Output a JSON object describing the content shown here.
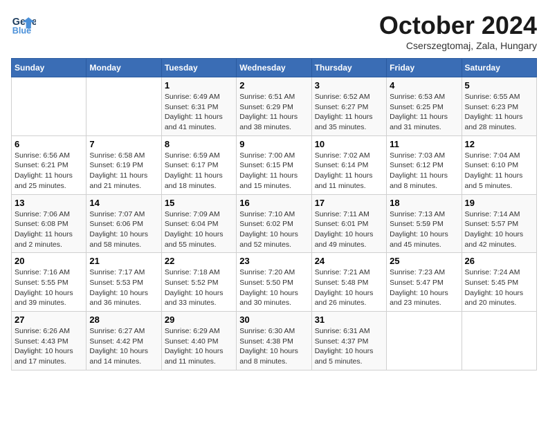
{
  "header": {
    "logo_line1": "General",
    "logo_line2": "Blue",
    "month_title": "October 2024",
    "subtitle": "Cserszegtomaj, Zala, Hungary"
  },
  "days_of_week": [
    "Sunday",
    "Monday",
    "Tuesday",
    "Wednesday",
    "Thursday",
    "Friday",
    "Saturday"
  ],
  "weeks": [
    [
      {
        "day": "",
        "sunrise": "",
        "sunset": "",
        "daylight": ""
      },
      {
        "day": "",
        "sunrise": "",
        "sunset": "",
        "daylight": ""
      },
      {
        "day": "1",
        "sunrise": "Sunrise: 6:49 AM",
        "sunset": "Sunset: 6:31 PM",
        "daylight": "Daylight: 11 hours and 41 minutes."
      },
      {
        "day": "2",
        "sunrise": "Sunrise: 6:51 AM",
        "sunset": "Sunset: 6:29 PM",
        "daylight": "Daylight: 11 hours and 38 minutes."
      },
      {
        "day": "3",
        "sunrise": "Sunrise: 6:52 AM",
        "sunset": "Sunset: 6:27 PM",
        "daylight": "Daylight: 11 hours and 35 minutes."
      },
      {
        "day": "4",
        "sunrise": "Sunrise: 6:53 AM",
        "sunset": "Sunset: 6:25 PM",
        "daylight": "Daylight: 11 hours and 31 minutes."
      },
      {
        "day": "5",
        "sunrise": "Sunrise: 6:55 AM",
        "sunset": "Sunset: 6:23 PM",
        "daylight": "Daylight: 11 hours and 28 minutes."
      }
    ],
    [
      {
        "day": "6",
        "sunrise": "Sunrise: 6:56 AM",
        "sunset": "Sunset: 6:21 PM",
        "daylight": "Daylight: 11 hours and 25 minutes."
      },
      {
        "day": "7",
        "sunrise": "Sunrise: 6:58 AM",
        "sunset": "Sunset: 6:19 PM",
        "daylight": "Daylight: 11 hours and 21 minutes."
      },
      {
        "day": "8",
        "sunrise": "Sunrise: 6:59 AM",
        "sunset": "Sunset: 6:17 PM",
        "daylight": "Daylight: 11 hours and 18 minutes."
      },
      {
        "day": "9",
        "sunrise": "Sunrise: 7:00 AM",
        "sunset": "Sunset: 6:15 PM",
        "daylight": "Daylight: 11 hours and 15 minutes."
      },
      {
        "day": "10",
        "sunrise": "Sunrise: 7:02 AM",
        "sunset": "Sunset: 6:14 PM",
        "daylight": "Daylight: 11 hours and 11 minutes."
      },
      {
        "day": "11",
        "sunrise": "Sunrise: 7:03 AM",
        "sunset": "Sunset: 6:12 PM",
        "daylight": "Daylight: 11 hours and 8 minutes."
      },
      {
        "day": "12",
        "sunrise": "Sunrise: 7:04 AM",
        "sunset": "Sunset: 6:10 PM",
        "daylight": "Daylight: 11 hours and 5 minutes."
      }
    ],
    [
      {
        "day": "13",
        "sunrise": "Sunrise: 7:06 AM",
        "sunset": "Sunset: 6:08 PM",
        "daylight": "Daylight: 11 hours and 2 minutes."
      },
      {
        "day": "14",
        "sunrise": "Sunrise: 7:07 AM",
        "sunset": "Sunset: 6:06 PM",
        "daylight": "Daylight: 10 hours and 58 minutes."
      },
      {
        "day": "15",
        "sunrise": "Sunrise: 7:09 AM",
        "sunset": "Sunset: 6:04 PM",
        "daylight": "Daylight: 10 hours and 55 minutes."
      },
      {
        "day": "16",
        "sunrise": "Sunrise: 7:10 AM",
        "sunset": "Sunset: 6:02 PM",
        "daylight": "Daylight: 10 hours and 52 minutes."
      },
      {
        "day": "17",
        "sunrise": "Sunrise: 7:11 AM",
        "sunset": "Sunset: 6:01 PM",
        "daylight": "Daylight: 10 hours and 49 minutes."
      },
      {
        "day": "18",
        "sunrise": "Sunrise: 7:13 AM",
        "sunset": "Sunset: 5:59 PM",
        "daylight": "Daylight: 10 hours and 45 minutes."
      },
      {
        "day": "19",
        "sunrise": "Sunrise: 7:14 AM",
        "sunset": "Sunset: 5:57 PM",
        "daylight": "Daylight: 10 hours and 42 minutes."
      }
    ],
    [
      {
        "day": "20",
        "sunrise": "Sunrise: 7:16 AM",
        "sunset": "Sunset: 5:55 PM",
        "daylight": "Daylight: 10 hours and 39 minutes."
      },
      {
        "day": "21",
        "sunrise": "Sunrise: 7:17 AM",
        "sunset": "Sunset: 5:53 PM",
        "daylight": "Daylight: 10 hours and 36 minutes."
      },
      {
        "day": "22",
        "sunrise": "Sunrise: 7:18 AM",
        "sunset": "Sunset: 5:52 PM",
        "daylight": "Daylight: 10 hours and 33 minutes."
      },
      {
        "day": "23",
        "sunrise": "Sunrise: 7:20 AM",
        "sunset": "Sunset: 5:50 PM",
        "daylight": "Daylight: 10 hours and 30 minutes."
      },
      {
        "day": "24",
        "sunrise": "Sunrise: 7:21 AM",
        "sunset": "Sunset: 5:48 PM",
        "daylight": "Daylight: 10 hours and 26 minutes."
      },
      {
        "day": "25",
        "sunrise": "Sunrise: 7:23 AM",
        "sunset": "Sunset: 5:47 PM",
        "daylight": "Daylight: 10 hours and 23 minutes."
      },
      {
        "day": "26",
        "sunrise": "Sunrise: 7:24 AM",
        "sunset": "Sunset: 5:45 PM",
        "daylight": "Daylight: 10 hours and 20 minutes."
      }
    ],
    [
      {
        "day": "27",
        "sunrise": "Sunrise: 6:26 AM",
        "sunset": "Sunset: 4:43 PM",
        "daylight": "Daylight: 10 hours and 17 minutes."
      },
      {
        "day": "28",
        "sunrise": "Sunrise: 6:27 AM",
        "sunset": "Sunset: 4:42 PM",
        "daylight": "Daylight: 10 hours and 14 minutes."
      },
      {
        "day": "29",
        "sunrise": "Sunrise: 6:29 AM",
        "sunset": "Sunset: 4:40 PM",
        "daylight": "Daylight: 10 hours and 11 minutes."
      },
      {
        "day": "30",
        "sunrise": "Sunrise: 6:30 AM",
        "sunset": "Sunset: 4:38 PM",
        "daylight": "Daylight: 10 hours and 8 minutes."
      },
      {
        "day": "31",
        "sunrise": "Sunrise: 6:31 AM",
        "sunset": "Sunset: 4:37 PM",
        "daylight": "Daylight: 10 hours and 5 minutes."
      },
      {
        "day": "",
        "sunrise": "",
        "sunset": "",
        "daylight": ""
      },
      {
        "day": "",
        "sunrise": "",
        "sunset": "",
        "daylight": ""
      }
    ]
  ]
}
